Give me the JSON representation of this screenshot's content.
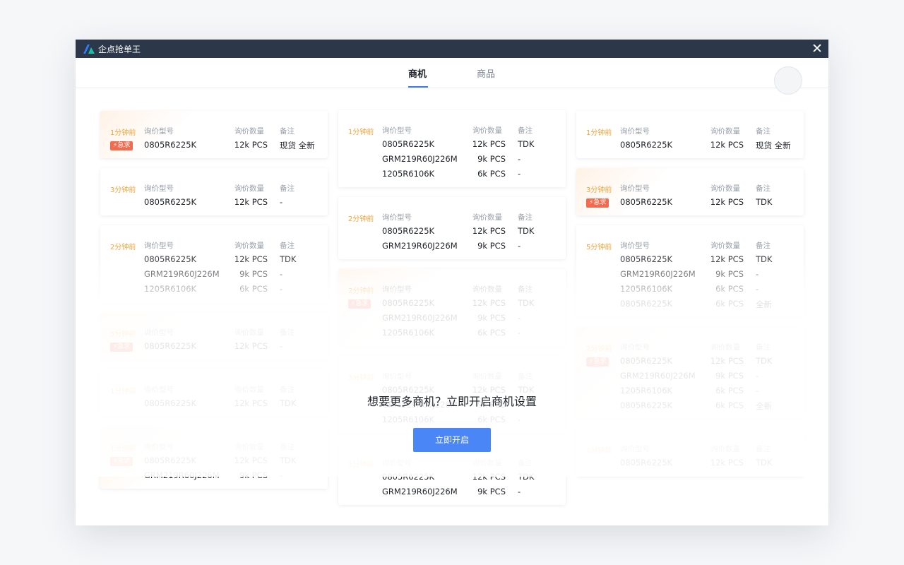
{
  "app": {
    "title": "企点抢单王",
    "close_icon": "close-icon",
    "logo_icon": "brand-logo-icon"
  },
  "tabs": [
    {
      "label": "商机",
      "active": true
    },
    {
      "label": "商品",
      "active": false
    }
  ],
  "headers": {
    "model": "询价型号",
    "qty": "询价数量",
    "note": "备注"
  },
  "urgent_label": "急求",
  "columns": [
    [
      {
        "time": "1分钟前",
        "urgent": true,
        "items": [
          {
            "model": "0805R6225K",
            "qty": "12k PCS",
            "note": "现货 全新"
          }
        ]
      },
      {
        "time": "3分钟前",
        "urgent": false,
        "items": [
          {
            "model": "0805R6225K",
            "qty": "12k PCS",
            "note": "-"
          }
        ]
      },
      {
        "time": "2分钟前",
        "urgent": false,
        "items": [
          {
            "model": "0805R6225K",
            "qty": "12k PCS",
            "note": "TDK"
          },
          {
            "model": "GRM219R60J226M",
            "qty": "9k PCS",
            "note": "-"
          },
          {
            "model": "1205R6106K",
            "qty": "6k PCS",
            "note": "-"
          }
        ]
      },
      {
        "time": "5分钟前",
        "urgent": true,
        "items": [
          {
            "model": "0805R6225K",
            "qty": "12k PCS",
            "note": "-"
          }
        ]
      },
      {
        "time": "1分钟前",
        "urgent": false,
        "items": [
          {
            "model": "0805R6225K",
            "qty": "12k PCS",
            "note": "TDK"
          }
        ]
      },
      {
        "time": "1分钟前",
        "urgent": true,
        "items": [
          {
            "model": "0805R6225K",
            "qty": "12k PCS",
            "note": "TDK"
          },
          {
            "model": "GRM219R60J226M",
            "qty": "9k PCS",
            "note": "-"
          }
        ]
      }
    ],
    [
      {
        "time": "1分钟前",
        "urgent": false,
        "items": [
          {
            "model": "0805R6225K",
            "qty": "12k PCS",
            "note": "TDK"
          },
          {
            "model": "GRM219R60J226M",
            "qty": "9k PCS",
            "note": "-"
          },
          {
            "model": "1205R6106K",
            "qty": "6k PCS",
            "note": "-"
          }
        ]
      },
      {
        "time": "2分钟前",
        "urgent": false,
        "items": [
          {
            "model": "0805R6225K",
            "qty": "12k PCS",
            "note": "TDK"
          },
          {
            "model": "GRM219R60J226M",
            "qty": "9k PCS",
            "note": "-"
          }
        ]
      },
      {
        "time": "2分钟前",
        "urgent": true,
        "items": [
          {
            "model": "0805R6225K",
            "qty": "12k PCS",
            "note": "TDK"
          },
          {
            "model": "GRM219R60J226M",
            "qty": "9k PCS",
            "note": "-"
          },
          {
            "model": "1205R6106K",
            "qty": "6k PCS",
            "note": "-"
          }
        ]
      },
      {
        "time": "3分钟前",
        "urgent": false,
        "items": [
          {
            "model": "0805R6225K",
            "qty": "12k PCS",
            "note": "TDK"
          },
          {
            "model": "GRM219R60J226M",
            "qty": "9k PCS",
            "note": "-"
          },
          {
            "model": "1205R6106K",
            "qty": "6k PCS",
            "note": "-"
          }
        ]
      },
      {
        "time": "1分钟前",
        "urgent": false,
        "items": [
          {
            "model": "0805R6225K",
            "qty": "12k PCS",
            "note": "TDK"
          },
          {
            "model": "GRM219R60J226M",
            "qty": "9k PCS",
            "note": "-"
          }
        ]
      }
    ],
    [
      {
        "time": "1分钟前",
        "urgent": false,
        "items": [
          {
            "model": "0805R6225K",
            "qty": "12k PCS",
            "note": "现货 全新"
          }
        ]
      },
      {
        "time": "3分钟前",
        "urgent": true,
        "items": [
          {
            "model": "0805R6225K",
            "qty": "12k PCS",
            "note": "TDK"
          }
        ]
      },
      {
        "time": "5分钟前",
        "urgent": false,
        "items": [
          {
            "model": "0805R6225K",
            "qty": "12k PCS",
            "note": "TDK"
          },
          {
            "model": "GRM219R60J226M",
            "qty": "9k PCS",
            "note": "-"
          },
          {
            "model": "1205R6106K",
            "qty": "6k PCS",
            "note": "-"
          },
          {
            "model": "0805R6225K",
            "qty": "6k PCS",
            "note": "全新"
          }
        ]
      },
      {
        "time": "2分钟前",
        "urgent": true,
        "items": [
          {
            "model": "0805R6225K",
            "qty": "12k PCS",
            "note": "TDK"
          },
          {
            "model": "GRM219R60J226M",
            "qty": "9k PCS",
            "note": "-"
          },
          {
            "model": "1205R6106K",
            "qty": "6k PCS",
            "note": "-"
          },
          {
            "model": "0805R6225K",
            "qty": "6k PCS",
            "note": "全新"
          }
        ]
      },
      {
        "time": "1分钟前",
        "urgent": false,
        "items": [
          {
            "model": "0805R6225K",
            "qty": "12k PCS",
            "note": "TDK"
          }
        ]
      }
    ]
  ],
  "cta": {
    "text": "想要更多商机？立即开启商机设置",
    "button_label": "立即开启"
  }
}
